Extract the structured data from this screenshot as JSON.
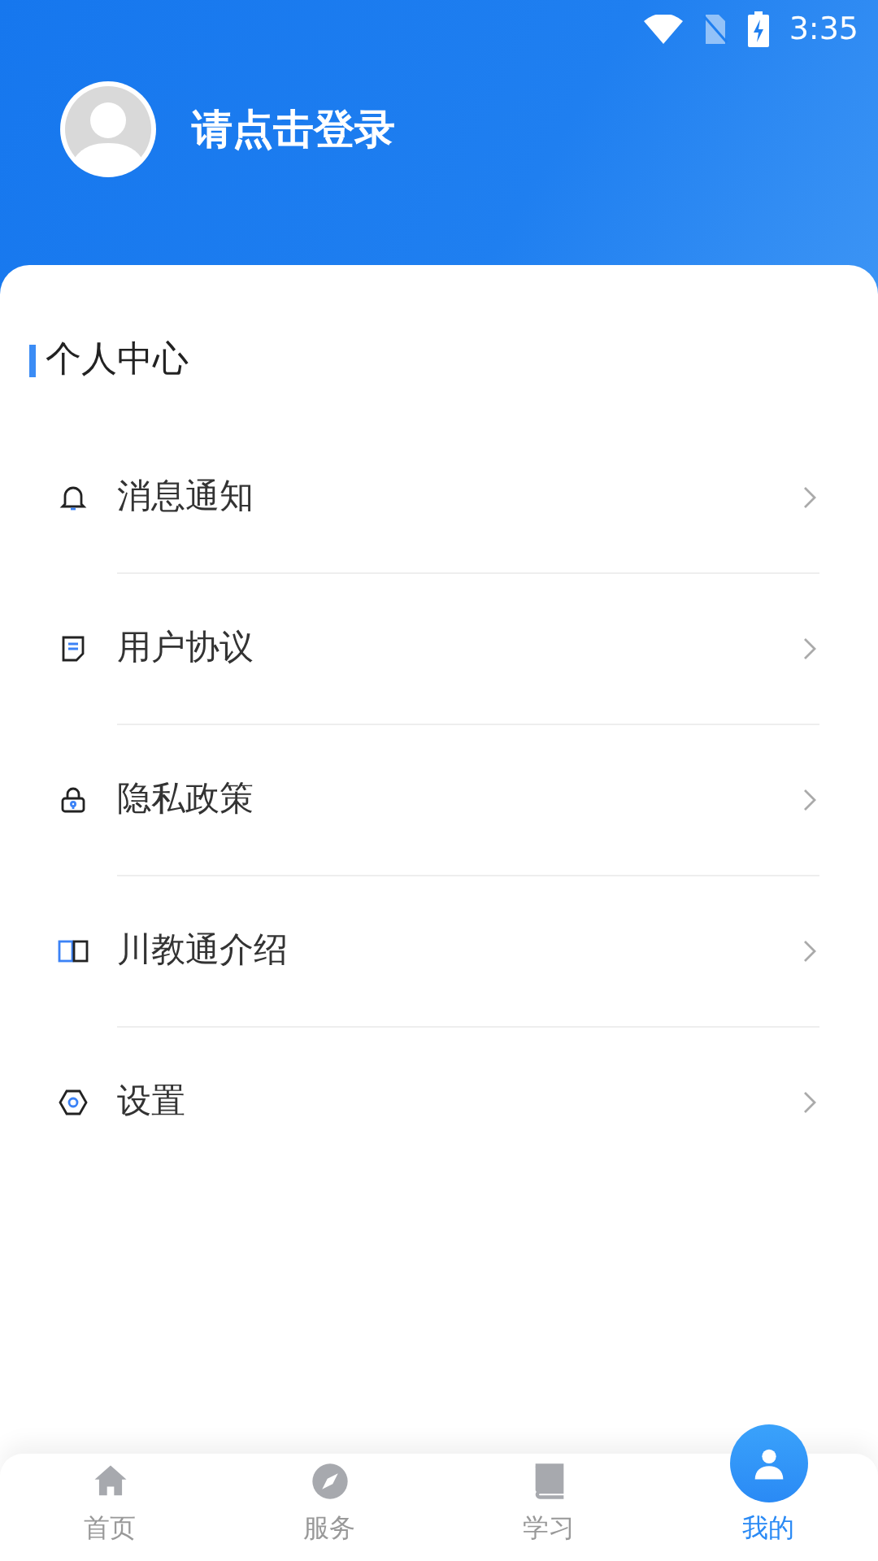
{
  "status_bar": {
    "time": "3:35"
  },
  "header": {
    "login_prompt": "请点击登录"
  },
  "section": {
    "title": "个人中心"
  },
  "menu": [
    {
      "kind": "bell",
      "label": "消息通知"
    },
    {
      "kind": "document",
      "label": "用户协议"
    },
    {
      "kind": "lock",
      "label": "隐私政策"
    },
    {
      "kind": "book",
      "label": "川教通介绍"
    },
    {
      "kind": "gear",
      "label": "设置"
    }
  ],
  "tabs": [
    {
      "kind": "home",
      "label": "首页",
      "selected": false
    },
    {
      "kind": "compass",
      "label": "服务",
      "selected": false
    },
    {
      "kind": "book",
      "label": "学习",
      "selected": false
    },
    {
      "kind": "person",
      "label": "我的",
      "selected": true
    }
  ]
}
